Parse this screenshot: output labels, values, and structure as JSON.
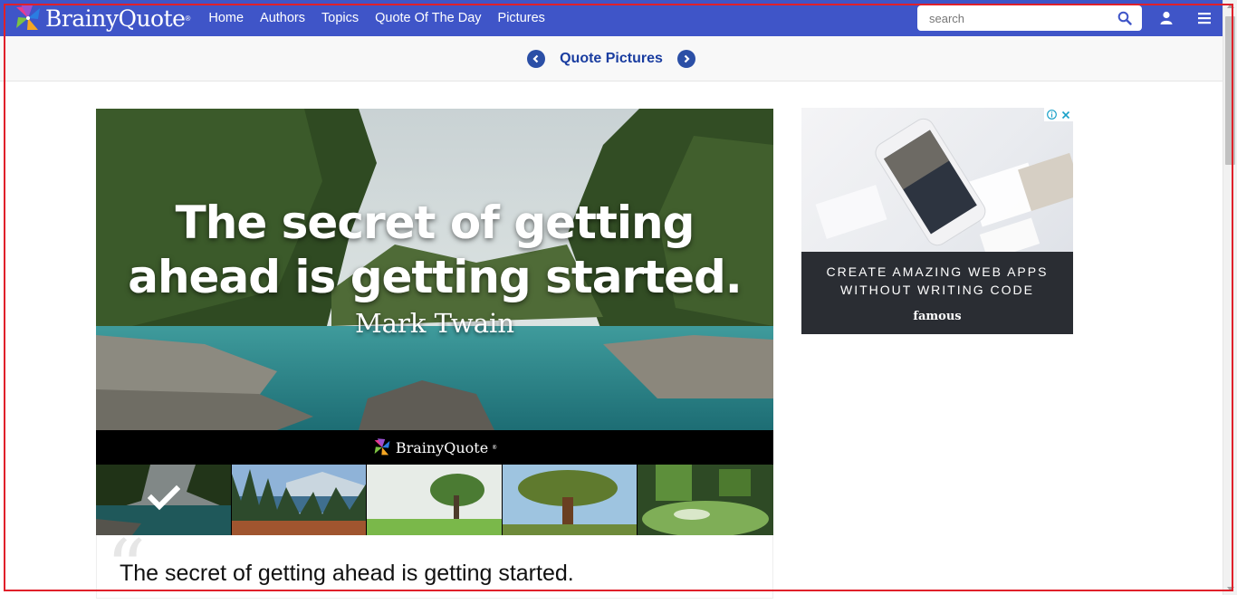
{
  "header": {
    "logo_text": "BrainyQuote",
    "logo_reg": "®",
    "nav": [
      "Home",
      "Authors",
      "Topics",
      "Quote Of The Day",
      "Pictures"
    ],
    "search_placeholder": "search"
  },
  "subheader": {
    "title": "Quote Pictures"
  },
  "picture": {
    "quote_line1": "The secret of getting",
    "quote_line2": "ahead is getting started.",
    "author": "Mark Twain",
    "brand_text": "BrainyQuote",
    "brand_reg": "®"
  },
  "thumbnails": [
    {
      "name": "river-forest",
      "selected": true
    },
    {
      "name": "lake-pines",
      "selected": false
    },
    {
      "name": "meadow-tree",
      "selected": false
    },
    {
      "name": "lone-pine",
      "selected": false
    },
    {
      "name": "forest-flowers",
      "selected": false
    }
  ],
  "quote_card": {
    "text": "The secret of getting ahead is getting started.",
    "mark": "“"
  },
  "ad": {
    "line1": "CREATE AMAZING WEB APPS",
    "line2": "WITHOUT WRITING CODE",
    "brand": "famous"
  },
  "colors": {
    "nav_bg": "#3f55c8",
    "accent": "#1a3da0",
    "ad_bg": "#2a2d33"
  }
}
